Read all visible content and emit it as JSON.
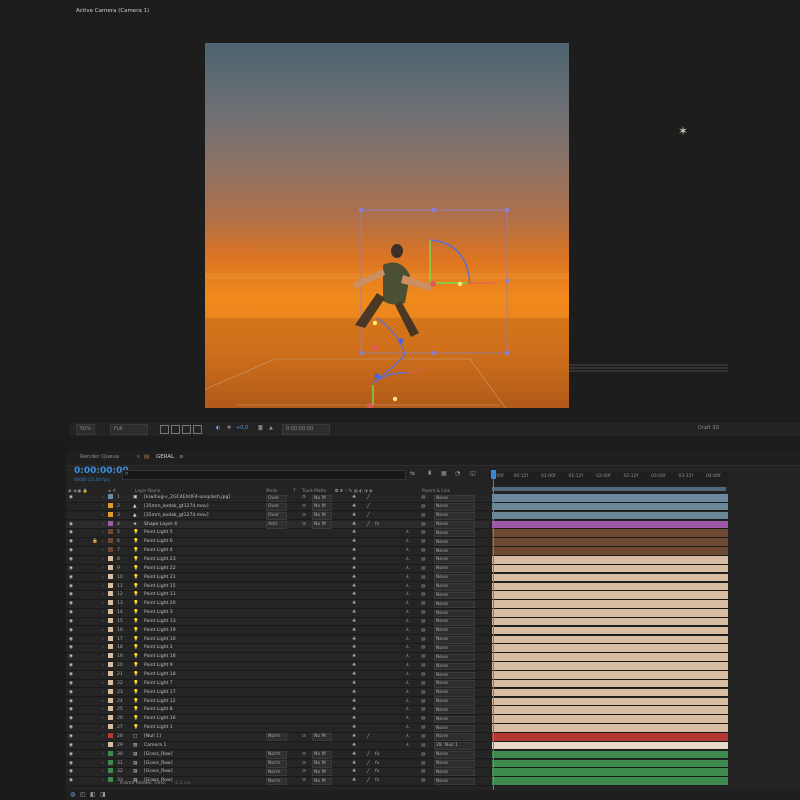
{
  "viewer": {
    "title": "Active Camera (Camera 1)",
    "zoom": "50%",
    "resolution": "Full",
    "exposure": "+0,0",
    "time": "0:00:00:00",
    "renderer": "Draft 3D"
  },
  "timeline": {
    "tabs": [
      "Render Queue",
      "GERAL"
    ],
    "timecode": "0:00:00:00",
    "fps_info": "00000 (25.00 fps)",
    "search_placeholder": "",
    "headers": {
      "layer_name": "Layer Name",
      "mode": "Mode",
      "t": "T",
      "track_matte": "Track Matte",
      "parent": "Parent & Link"
    },
    "ruler_ticks": [
      "0:00f",
      "00:12f",
      "01:00f",
      "01:12f",
      "02:00f",
      "02:12f",
      "03:00f",
      "03:12f",
      "04:00f"
    ],
    "frame_render_label": "Frame Render Time:",
    "frame_render_value": "4,3 ms",
    "colors": {
      "accent": "#3b8fe0",
      "peach": "#d9bda3",
      "purple": "#9b59a8",
      "brown": "#6e4a35",
      "blue_gray": "#6e8aa0",
      "red": "#b23a32",
      "green": "#3f8a4e"
    }
  },
  "layers": [
    {
      "num": "1",
      "name": "[kiwihug-v_2GC4EhOF4-unsplash.jpg]",
      "icon": "image-icon",
      "mode": "Over",
      "matte": "No M",
      "parent": "None",
      "color": "#6e8aa0",
      "bar": "#6e8aa0",
      "eye": true
    },
    {
      "num": "2",
      "name": "[35mm_kodak_gt1274.mov]",
      "icon": "footage-icon",
      "mode": "Over",
      "matte": "No M",
      "parent": "None",
      "color": "#e09a2a",
      "bar": "#6a8898",
      "eye": false
    },
    {
      "num": "3",
      "name": "[35mm_kodak_gt1274.mov]",
      "icon": "footage-icon",
      "mode": "Over",
      "matte": "No M",
      "parent": "None",
      "color": "#e09a2a",
      "bar": "#6a8898",
      "eye": false
    },
    {
      "num": "4",
      "name": "Shape Layer 4",
      "icon": "star-icon",
      "mode": "Add",
      "matte": "No M",
      "parent": "None",
      "color": "#9b59a8",
      "bar": "#9b59a8",
      "eye": true
    },
    {
      "num": "5",
      "name": "Point Light 5",
      "icon": "light-icon",
      "mode": "",
      "matte": "",
      "parent": "None",
      "color": "#6e4a35",
      "bar": "#6e4a35",
      "eye": true
    },
    {
      "num": "6",
      "name": "Point Light 6",
      "icon": "light-icon",
      "mode": "",
      "matte": "",
      "parent": "None",
      "color": "#6e4a35",
      "bar": "#6e4a35",
      "eye": true
    },
    {
      "num": "7",
      "name": "Point Light 4",
      "icon": "light-icon",
      "mode": "",
      "matte": "",
      "parent": "None",
      "color": "#6e4a35",
      "bar": "#6e4a35",
      "eye": true
    },
    {
      "num": "8",
      "name": "Point Light 23",
      "icon": "light-icon",
      "mode": "",
      "matte": "",
      "parent": "None",
      "color": "#d9bda3",
      "bar": "#d9bda3",
      "eye": true
    },
    {
      "num": "9",
      "name": "Point Light 22",
      "icon": "light-icon",
      "mode": "",
      "matte": "",
      "parent": "None",
      "color": "#d9bda3",
      "bar": "#d9bda3",
      "eye": true
    },
    {
      "num": "10",
      "name": "Point Light 21",
      "icon": "light-icon",
      "mode": "",
      "matte": "",
      "parent": "None",
      "color": "#d9bda3",
      "bar": "#d9bda3",
      "eye": true
    },
    {
      "num": "11",
      "name": "Point Light 15",
      "icon": "light-icon",
      "mode": "",
      "matte": "",
      "parent": "None",
      "color": "#d9bda3",
      "bar": "#d9bda3",
      "eye": true
    },
    {
      "num": "12",
      "name": "Point Light 11",
      "icon": "light-icon",
      "mode": "",
      "matte": "",
      "parent": "None",
      "color": "#d9bda3",
      "bar": "#d9bda3",
      "eye": true
    },
    {
      "num": "13",
      "name": "Point Light 20",
      "icon": "light-icon",
      "mode": "",
      "matte": "",
      "parent": "None",
      "color": "#d9bda3",
      "bar": "#d9bda3",
      "eye": true
    },
    {
      "num": "14",
      "name": "Point Light 3",
      "icon": "light-icon",
      "mode": "",
      "matte": "",
      "parent": "None",
      "color": "#d9bda3",
      "bar": "#d9bda3",
      "eye": true
    },
    {
      "num": "15",
      "name": "Point Light 13",
      "icon": "light-icon",
      "mode": "",
      "matte": "",
      "parent": "None",
      "color": "#d9bda3",
      "bar": "#d9bda3",
      "eye": true
    },
    {
      "num": "16",
      "name": "Point Light 19",
      "icon": "light-icon",
      "mode": "",
      "matte": "",
      "parent": "None",
      "color": "#d9bda3",
      "bar": "#d9bda3",
      "eye": true
    },
    {
      "num": "17",
      "name": "Point Light 10",
      "icon": "light-icon",
      "mode": "",
      "matte": "",
      "parent": "None",
      "color": "#d9bda3",
      "bar": "#d9bda3",
      "eye": true
    },
    {
      "num": "18",
      "name": "Point Light 2",
      "icon": "light-icon",
      "mode": "",
      "matte": "",
      "parent": "None",
      "color": "#d9bda3",
      "bar": "#d9bda3",
      "eye": true
    },
    {
      "num": "19",
      "name": "Point Light 18",
      "icon": "light-icon",
      "mode": "",
      "matte": "",
      "parent": "None",
      "color": "#d9bda3",
      "bar": "#d9bda3",
      "eye": true
    },
    {
      "num": "20",
      "name": "Point Light 9",
      "icon": "light-icon",
      "mode": "",
      "matte": "",
      "parent": "None",
      "color": "#d9bda3",
      "bar": "#d9bda3",
      "eye": true
    },
    {
      "num": "21",
      "name": "Point Light 18",
      "icon": "light-icon",
      "mode": "",
      "matte": "",
      "parent": "None",
      "color": "#d9bda3",
      "bar": "#d9bda3",
      "eye": true
    },
    {
      "num": "22",
      "name": "Point Light 7",
      "icon": "light-icon",
      "mode": "",
      "matte": "",
      "parent": "None",
      "color": "#d9bda3",
      "bar": "#d9bda3",
      "eye": true
    },
    {
      "num": "23",
      "name": "Point Light 17",
      "icon": "light-icon",
      "mode": "",
      "matte": "",
      "parent": "None",
      "color": "#d9bda3",
      "bar": "#d9bda3",
      "eye": true
    },
    {
      "num": "24",
      "name": "Point Light 12",
      "icon": "light-icon",
      "mode": "",
      "matte": "",
      "parent": "None",
      "color": "#d9bda3",
      "bar": "#d9bda3",
      "eye": true
    },
    {
      "num": "25",
      "name": "Point Light 8",
      "icon": "light-icon",
      "mode": "",
      "matte": "",
      "parent": "None",
      "color": "#d9bda3",
      "bar": "#d9bda3",
      "eye": true
    },
    {
      "num": "26",
      "name": "Point Light 16",
      "icon": "light-icon",
      "mode": "",
      "matte": "",
      "parent": "None",
      "color": "#d9bda3",
      "bar": "#d9bda3",
      "eye": true
    },
    {
      "num": "27",
      "name": "Point Light 1",
      "icon": "light-icon",
      "mode": "",
      "matte": "",
      "parent": "None",
      "color": "#d9bda3",
      "bar": "#d9bda3",
      "eye": true
    },
    {
      "num": "28",
      "name": "[Null 1]",
      "icon": "null-icon",
      "mode": "Norm",
      "matte": "No M",
      "parent": "None",
      "color": "#b23a32",
      "bar": "#b23a32",
      "eye": true
    },
    {
      "num": "29",
      "name": "Camera 1",
      "icon": "camera-icon",
      "mode": "",
      "matte": "",
      "parent": "28. Null 1",
      "color": "#d9bda3",
      "bar": "#e6d7c8",
      "eye": true
    },
    {
      "num": "30",
      "name": "[Grass_Row]",
      "icon": "comp-icon",
      "mode": "Norm",
      "matte": "No M",
      "parent": "None",
      "color": "#3f8a4e",
      "bar": "#3f8a4e",
      "eye": true
    },
    {
      "num": "31",
      "name": "[Grass_Row]",
      "icon": "comp-icon",
      "mode": "Norm",
      "matte": "No M",
      "parent": "None",
      "color": "#3f8a4e",
      "bar": "#3f8a4e",
      "eye": true
    },
    {
      "num": "32",
      "name": "[Grass_Row]",
      "icon": "comp-icon",
      "mode": "Norm",
      "matte": "No M",
      "parent": "None",
      "color": "#3f8a4e",
      "bar": "#3f8a4e",
      "eye": true
    },
    {
      "num": "33",
      "name": "[Grass_Row]",
      "icon": "comp-icon",
      "mode": "Norm",
      "matte": "No M",
      "parent": "None",
      "color": "#3f8a4e",
      "bar": "#3f8a4e",
      "eye": true
    }
  ]
}
